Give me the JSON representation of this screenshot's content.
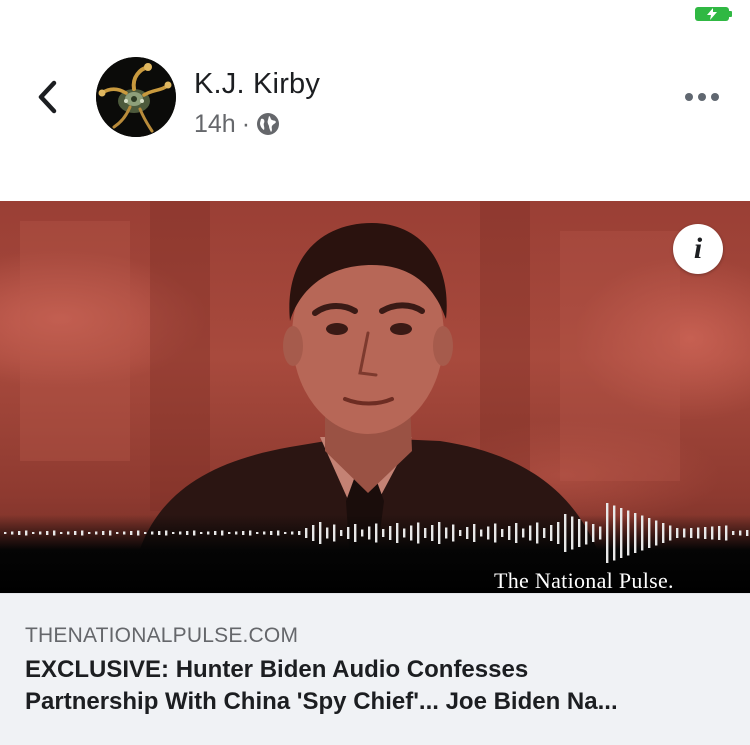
{
  "header": {
    "back_icon": "chevron-left-icon",
    "author_name": "K.J. Kirby",
    "time_ago": "14h",
    "separator": "·",
    "privacy_icon": "globe-icon",
    "more_icon": "more-horizontal-icon"
  },
  "status_bar": {
    "battery_icon": "battery-charging-icon",
    "battery_color": "#30b843"
  },
  "media": {
    "brand_watermark": "The National Pulse.",
    "info_label": "i",
    "tint_color": "#a84a3d"
  },
  "link": {
    "domain": "THENATIONALPULSE.COM",
    "title_line1": "EXCLUSIVE: Hunter Biden Audio Confesses",
    "title_line2": "Partnership With China 'Spy Chief'... Joe Biden Na..."
  }
}
